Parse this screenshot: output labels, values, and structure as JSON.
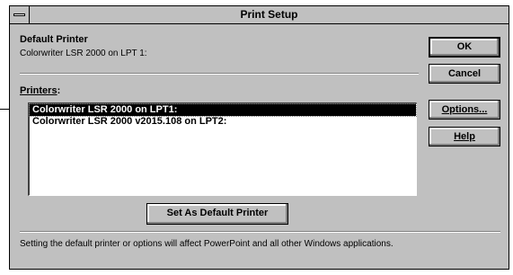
{
  "window": {
    "title": "Print Setup"
  },
  "default_printer": {
    "heading": "Default Printer",
    "value": "Colorwriter LSR 2000 on LPT 1:"
  },
  "printers": {
    "label": "Printers",
    "items": [
      {
        "label": "Colorwriter LSR 2000 on LPT1:",
        "selected": true
      },
      {
        "label": "Colorwriter LSR 2000 v2015.108 on LPT2:",
        "selected": false
      }
    ]
  },
  "buttons": {
    "ok": "OK",
    "cancel": "Cancel",
    "options": "Options...",
    "help": "Help",
    "set_default": "Set As Default Printer"
  },
  "footer": {
    "note": "Setting the default printer or options will affect PowerPoint and all other Windows applications."
  }
}
